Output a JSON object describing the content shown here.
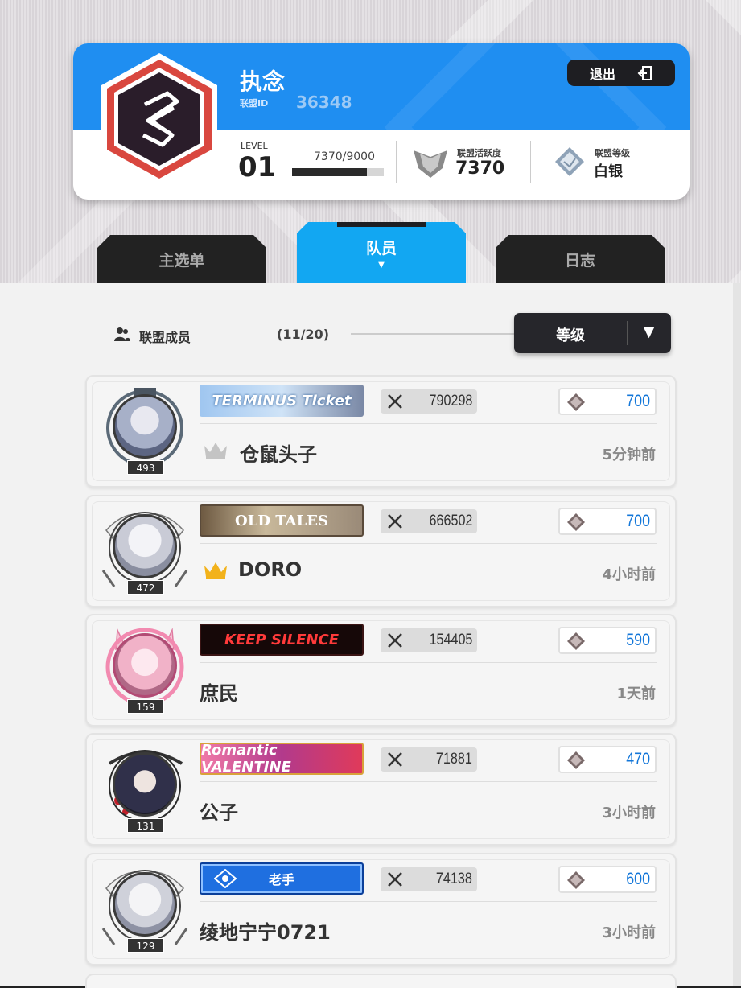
{
  "guild": {
    "name": "执念",
    "id_label": "联盟ID",
    "id": "36348",
    "exit_label": "退出",
    "level_label": "LEVEL",
    "level": "01",
    "exp_text": "7370/9000",
    "exp_progress": 0.819,
    "activity_label": "联盟活跃度",
    "activity": "7370",
    "rank_label": "联盟等级",
    "rank": "白银"
  },
  "tabs": [
    {
      "label": "主选单",
      "active": false
    },
    {
      "label": "队员",
      "active": true
    },
    {
      "label": "日志",
      "active": false
    }
  ],
  "members_header": {
    "label": "联盟成员",
    "count": "(11/20)",
    "sort_value": "等级"
  },
  "members": [
    {
      "level": "493",
      "banner": "TERMINUS Ticket",
      "power": "790298",
      "score": "700",
      "crown": "silver",
      "name": "仓鼠头子",
      "last_seen": "5分钟前"
    },
    {
      "level": "472",
      "banner": "OLD TALES",
      "power": "666502",
      "score": "700",
      "crown": "gold",
      "name": "DORO",
      "last_seen": "4小时前"
    },
    {
      "level": "159",
      "banner": "KEEP SILENCE",
      "power": "154405",
      "score": "590",
      "crown": "",
      "name": "庶民",
      "last_seen": "1天前"
    },
    {
      "level": "131",
      "banner": "Romantic VALENTINE",
      "power": "71881",
      "score": "470",
      "crown": "",
      "name": "公子",
      "last_seen": "3小时前"
    },
    {
      "level": "129",
      "banner": "老手",
      "power": "74138",
      "score": "600",
      "crown": "",
      "name": "绫地宁宁0721",
      "last_seen": "3小时前"
    }
  ],
  "colors": {
    "header_blue": "#1f8ef1",
    "tab_active": "#12a7f2",
    "score_blue": "#1477d9",
    "crown_gold": "#f2b21b",
    "crown_silver": "#c4c4c4"
  }
}
